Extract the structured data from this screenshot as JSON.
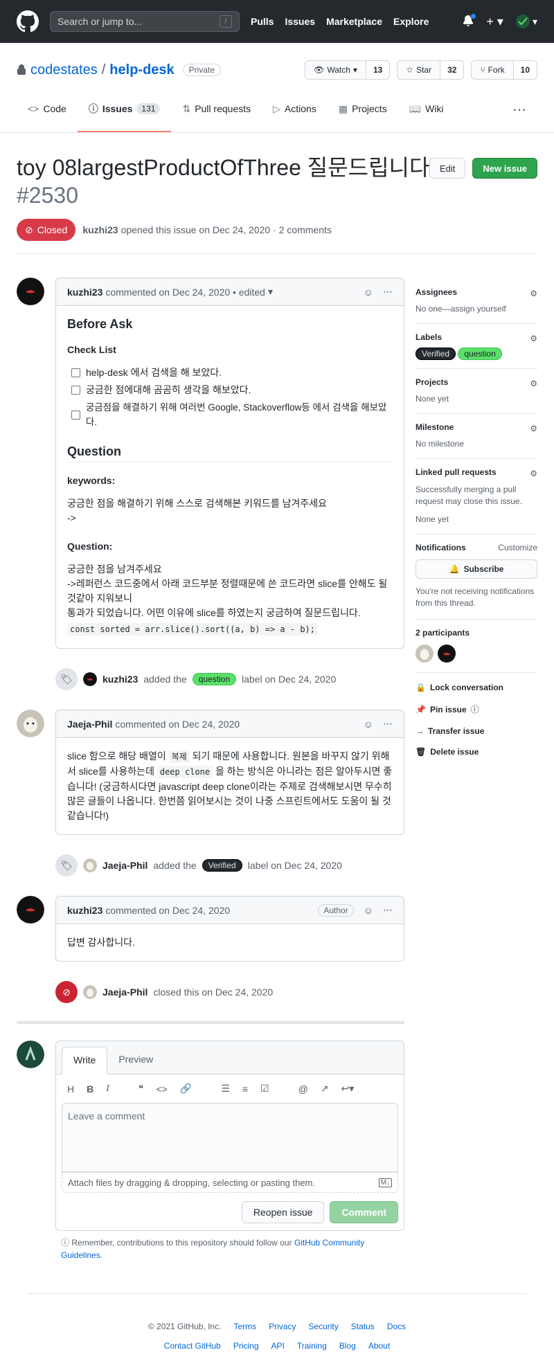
{
  "header": {
    "search_placeholder": "Search or jump to...",
    "slash": "/",
    "nav": [
      "Pulls",
      "Issues",
      "Marketplace",
      "Explore"
    ]
  },
  "repo": {
    "owner": "codestates",
    "sep": "/",
    "name": "help-desk",
    "visibility": "Private",
    "watch_label": "Watch",
    "watch_count": "13",
    "star_label": "Star",
    "star_count": "32",
    "fork_label": "Fork",
    "fork_count": "10"
  },
  "tabs": [
    {
      "label": "Code"
    },
    {
      "label": "Issues",
      "count": "131"
    },
    {
      "label": "Pull requests"
    },
    {
      "label": "Actions"
    },
    {
      "label": "Projects"
    },
    {
      "label": "Wiki"
    }
  ],
  "issue": {
    "title": "toy 08largestProductOfThree 질문드립니다.",
    "number": "#2530",
    "edit": "Edit",
    "new_issue": "New issue",
    "state": "Closed",
    "author": "kuzhi23",
    "meta_text": "opened this issue on Dec 24, 2020 · 2 comments"
  },
  "comments": {
    "c1": {
      "author": "kuzhi23",
      "meta": "commented on Dec 24, 2020 • edited",
      "h_before": "Before Ask",
      "h_checklist": "Check List",
      "checks": [
        "help-desk 에서 검색을 해 보았다.",
        "궁금한 점에대해 곰곰히 생각을 해보았다.",
        "궁금점을 해결하기 위해 여러번 Google, Stackoverflow등 에서 검색을 해보았다."
      ],
      "h_question": "Question",
      "h_keywords": "keywords:",
      "kw_line1": "궁금한 점을 해결하기 위해 스스로 검색해본 키워드를 남겨주세요",
      "kw_line2": "->",
      "h_question2": "Question:",
      "q_line1": "궁금한 점을 남겨주세요",
      "q_line2": "->레퍼런스 코드중에서 아래 코드부분 정렬때문에 쓴 코드라면 slice를 안해도 될것같아 지워보니",
      "q_line3": "통과가 되었습니다. 어떤 이유에 slice를 하였는지 궁금하여 질문드립니다.",
      "code": "const sorted = arr.slice().sort((a, b) => a - b);"
    },
    "e1": {
      "actor": "kuzhi23",
      "text1": "added the",
      "label": "question",
      "text2": "label on Dec 24, 2020"
    },
    "c2": {
      "author": "Jaeja-Phil",
      "meta": "commented on Dec 24, 2020",
      "p1": "slice 함으로 해당 배열이",
      "p1_code": "복제",
      "p2": "되기 때문에 사용합니다. 원본을 바꾸지 않기 위해서 slice를 사용하는데",
      "p2_code": "deep clone",
      "p3": "을 하는 방식은 아니라는 점은 알아두시면 좋습니다! (궁금하시다면 javascript deep clone이라는 주제로 검색해보시면 무수히 많은 글들이 나옵니다. 한번쯤 읽어보시는 것이 나중 스프린트에서도 도움이 될 것 같습니다!)"
    },
    "e2": {
      "actor": "Jaeja-Phil",
      "text1": "added the",
      "label": "Verified",
      "text2": "label on Dec 24, 2020"
    },
    "c3": {
      "author": "kuzhi23",
      "meta": "commented on Dec 24, 2020",
      "badge": "Author",
      "body": "답변 감사합니다."
    },
    "e3": {
      "actor": "Jaeja-Phil",
      "text": "closed this on Dec 24, 2020"
    }
  },
  "new_comment": {
    "tab_write": "Write",
    "tab_preview": "Preview",
    "placeholder": "Leave a comment",
    "attach": "Attach files by dragging & dropping, selecting or pasting them.",
    "reopen": "Reopen issue",
    "comment": "Comment",
    "remember_pre": "Remember, contributions to this repository should follow our",
    "remember_link": "GitHub Community Guidelines",
    "remember_post": "."
  },
  "sidebar": {
    "assignees_h": "Assignees",
    "assignees_v": "No one—assign yourself",
    "labels_h": "Labels",
    "label_verified": "Verified",
    "label_question": "question",
    "projects_h": "Projects",
    "projects_v": "None yet",
    "milestone_h": "Milestone",
    "milestone_v": "No milestone",
    "linked_h": "Linked pull requests",
    "linked_desc": "Successfully merging a pull request may close this issue.",
    "linked_v": "None yet",
    "notif_h": "Notifications",
    "customize": "Customize",
    "subscribe": "Subscribe",
    "notif_desc": "You're not receiving notifications from this thread.",
    "participants_h": "2 participants",
    "lock": "Lock conversation",
    "pin": "Pin issue",
    "transfer": "Transfer issue",
    "delete": "Delete issue"
  },
  "footer": {
    "copy": "© 2021 GitHub, Inc.",
    "row1": [
      "Terms",
      "Privacy",
      "Security",
      "Status",
      "Docs"
    ],
    "row2": [
      "Contact GitHub",
      "Pricing",
      "API",
      "Training",
      "Blog",
      "About"
    ]
  },
  "colors": {
    "closed": "#d73a49",
    "green": "#2ea44f",
    "accent": "#0366d6"
  }
}
